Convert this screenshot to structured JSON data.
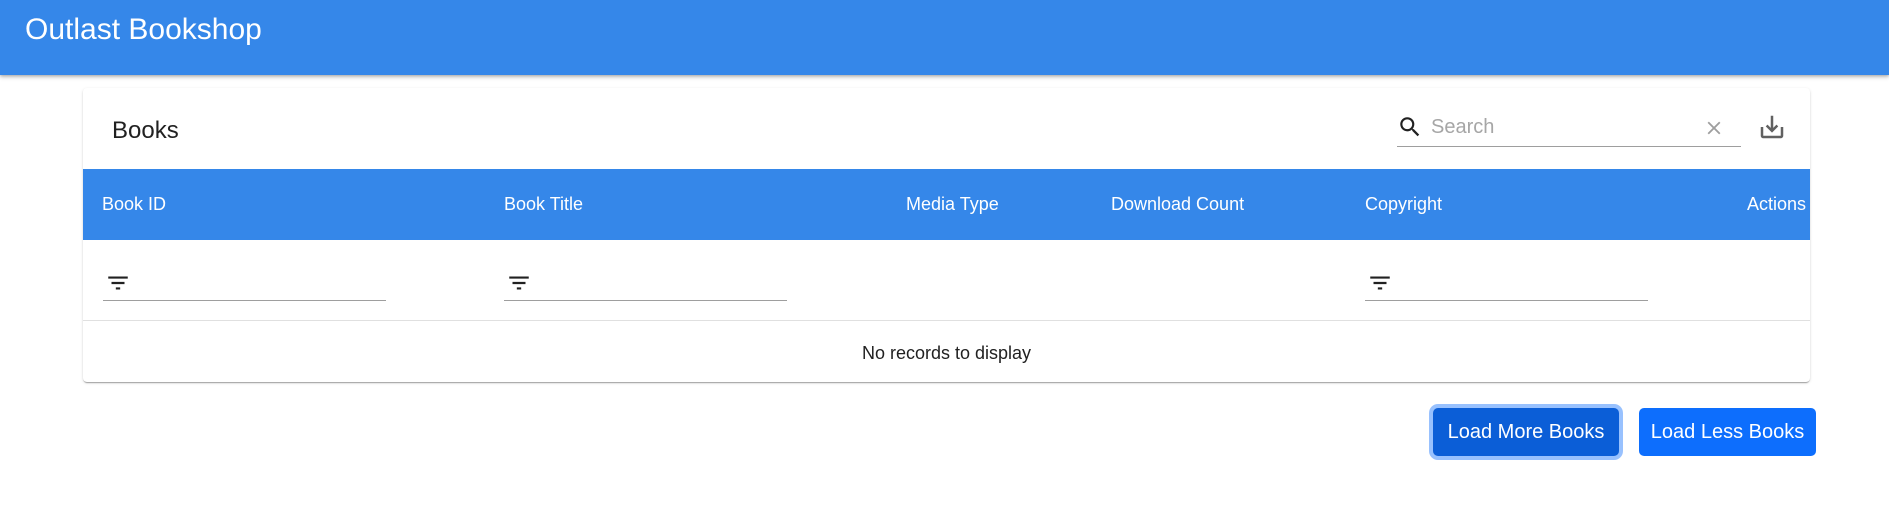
{
  "app": {
    "title": "Outlast Bookshop",
    "brand_color": "#3587e9"
  },
  "table": {
    "title": "Books",
    "search": {
      "placeholder": "Search",
      "value": ""
    },
    "columns": [
      "Book ID",
      "Book Title",
      "Media Type",
      "Download Count",
      "Copyright",
      "Actions"
    ],
    "filters": [
      {
        "column": "Book ID",
        "value": ""
      },
      {
        "column": "Book Title",
        "value": ""
      },
      {
        "column": "Copyright",
        "value": ""
      }
    ],
    "empty_message": "No records to display"
  },
  "actions": {
    "load_more_label": "Load More Books",
    "load_less_label": "Load Less Books",
    "button_color": "#0d6efd"
  },
  "icons": {
    "search": "search-icon",
    "clear": "close-icon",
    "export": "download-icon",
    "filter": "filter-list-icon"
  }
}
